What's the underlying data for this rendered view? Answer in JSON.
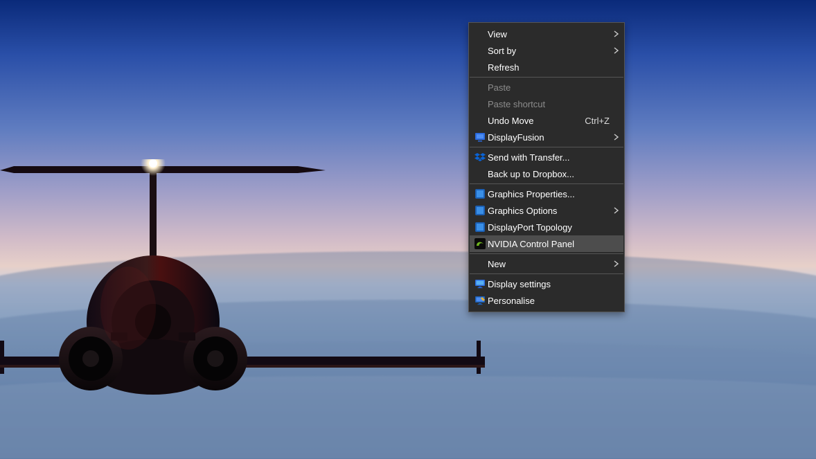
{
  "menu": {
    "view": "View",
    "sort_by": "Sort by",
    "refresh": "Refresh",
    "paste": "Paste",
    "paste_shortcut": "Paste shortcut",
    "undo_move": "Undo Move",
    "undo_move_shortcut": "Ctrl+Z",
    "displayfusion": "DisplayFusion",
    "send_with_transfer": "Send with Transfer...",
    "back_up_dropbox": "Back up to Dropbox...",
    "graphics_properties": "Graphics Properties...",
    "graphics_options": "Graphics Options",
    "displayport_topology": "DisplayPort Topology",
    "nvidia_control_panel": "NVIDIA Control Panel",
    "new": "New",
    "display_settings": "Display settings",
    "personalise": "Personalise"
  }
}
